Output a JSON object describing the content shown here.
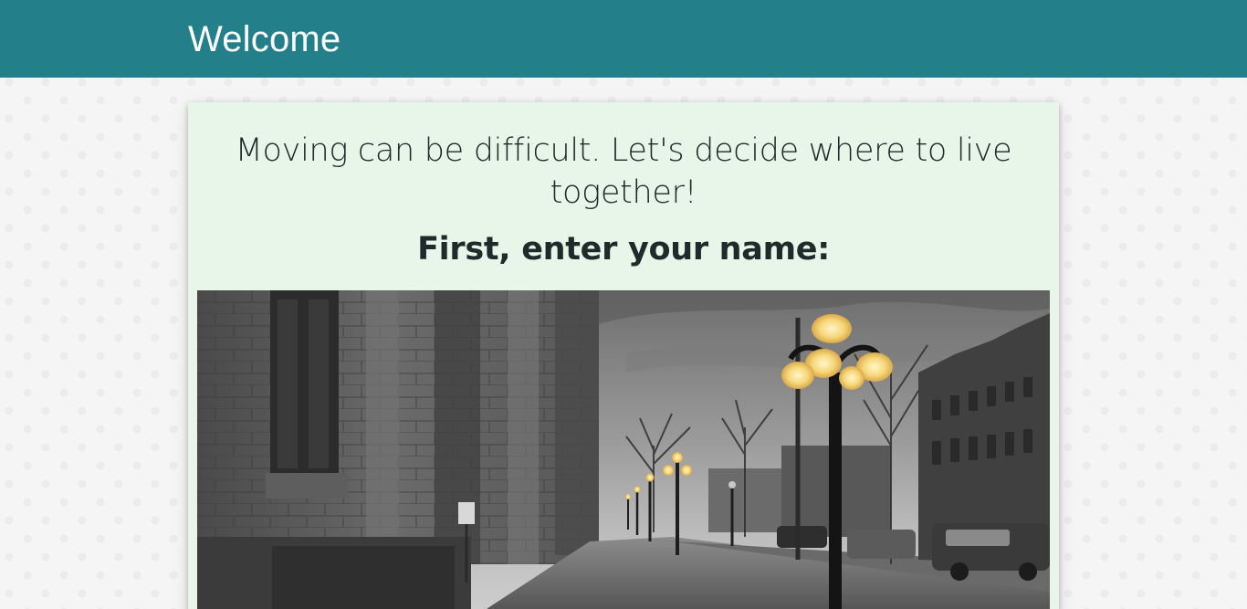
{
  "header": {
    "title": "Welcome",
    "background_color": "#237f8a"
  },
  "card": {
    "headline": "Moving can be difficult. Let's decide where to live together!",
    "prompt": "First, enter your name:",
    "background_color": "#e8f5e9",
    "image": {
      "subject": "black and white city street with lit street lamps"
    }
  }
}
